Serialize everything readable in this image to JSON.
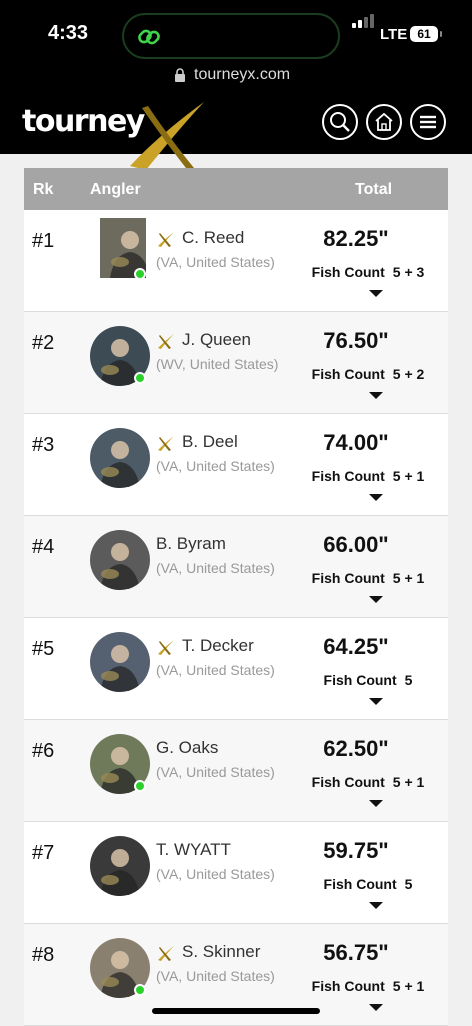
{
  "status_bar": {
    "time": "4:33",
    "network": "LTE",
    "battery": "61"
  },
  "browser": {
    "url": "tourneyx.com"
  },
  "brand": {
    "logo_text": "tourney",
    "accent_color": "#c9a227"
  },
  "columns": {
    "rank": "Rk",
    "angler": "Angler",
    "total": "Total"
  },
  "fish_count_label": "Fish Count",
  "rows": [
    {
      "rank": "#1",
      "name": "C. Reed",
      "location": "(VA, United States)",
      "total": "82.25\"",
      "fish_count": "5 + 3",
      "pro": true,
      "online": true,
      "avatar_color": "#6d6a5e"
    },
    {
      "rank": "#2",
      "name": "J. Queen",
      "location": "(WV, United States)",
      "total": "76.50\"",
      "fish_count": "5 + 2",
      "pro": true,
      "online": true,
      "avatar_color": "#3d4b55"
    },
    {
      "rank": "#3",
      "name": "B. Deel",
      "location": "(VA, United States)",
      "total": "74.00\"",
      "fish_count": "5 + 1",
      "pro": true,
      "online": false,
      "avatar_color": "#4d5b66"
    },
    {
      "rank": "#4",
      "name": "B. Byram",
      "location": "(VA, United States)",
      "total": "66.00\"",
      "fish_count": "5 + 1",
      "pro": false,
      "online": false,
      "avatar_color": "#5b5b5b"
    },
    {
      "rank": "#5",
      "name": "T. Decker",
      "location": "(VA, United States)",
      "total": "64.25\"",
      "fish_count": "5",
      "pro": true,
      "online": false,
      "avatar_color": "#556070"
    },
    {
      "rank": "#6",
      "name": "G. Oaks",
      "location": "(VA, United States)",
      "total": "62.50\"",
      "fish_count": "5 + 1",
      "pro": false,
      "online": true,
      "avatar_color": "#6f7a5a"
    },
    {
      "rank": "#7",
      "name": "T. WYATT",
      "location": "(VA, United States)",
      "total": "59.75\"",
      "fish_count": "5",
      "pro": false,
      "online": false,
      "avatar_color": "#3a3a3a"
    },
    {
      "rank": "#8",
      "name": "S. Skinner",
      "location": "(VA, United States)",
      "total": "56.75\"",
      "fish_count": "5 + 1",
      "pro": true,
      "online": true,
      "avatar_color": "#8a8070"
    }
  ]
}
